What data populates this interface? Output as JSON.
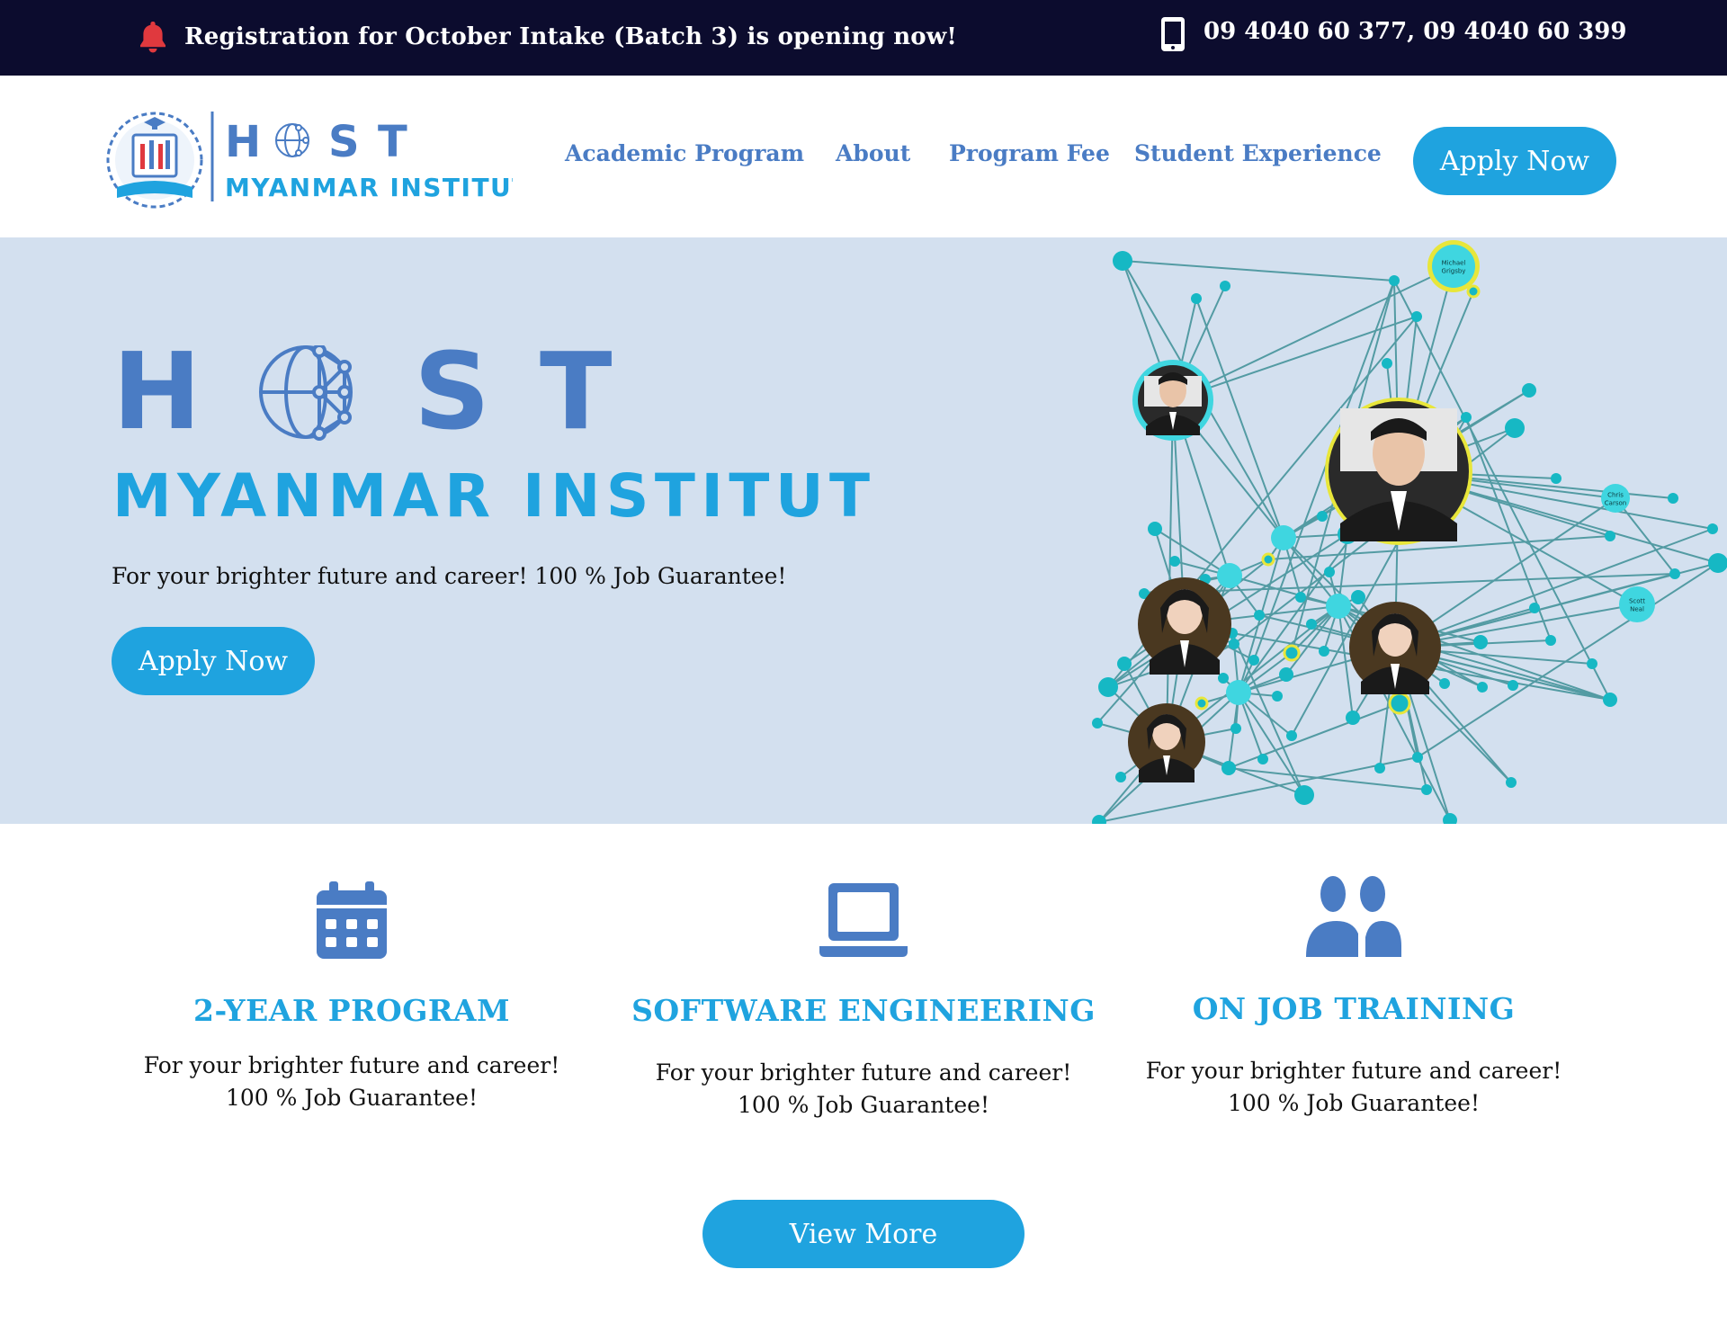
{
  "topbar": {
    "announcement": "Registration for October Intake (Batch 3) is opening now!",
    "phones": "09 4040 60 377, 09 4040 60 399",
    "bell_icon": "bell-icon",
    "phone_icon": "mobile-phone-icon"
  },
  "header": {
    "logo": {
      "word": "H   S T",
      "subtitle": "MYANMAR INSTITUTE"
    },
    "nav": [
      {
        "label": "Academic Program"
      },
      {
        "label": "About"
      },
      {
        "label": "Program Fee"
      },
      {
        "label": "Student Experience"
      }
    ],
    "apply_label": "Apply Now"
  },
  "hero": {
    "subtitle": "MYANMAR INSTITUTE",
    "tagline": "For your brighter future and career! 100 % Job Guarantee!",
    "apply_label": "Apply Now",
    "network_labels": [
      "Michael Grigsby",
      "Chris Carson",
      "Scott Neal"
    ]
  },
  "features": [
    {
      "icon": "calendar-icon",
      "title": "2-YEAR PROGRAM",
      "line1": "For your brighter future and career!",
      "line2": "100 % Job Guarantee!"
    },
    {
      "icon": "laptop-icon",
      "title": "SOFTWARE ENGINEERING",
      "line1": "For your brighter future and career!",
      "line2": "100 % Job Guarantee!"
    },
    {
      "icon": "users-icon",
      "title": "ON JOB TRAINING",
      "line1": "For your brighter future and career!",
      "line2": "100 % Job Guarantee!"
    }
  ],
  "view_more_label": "View More",
  "colors": {
    "topbar_bg": "#0c0c2e",
    "accent_blue": "#1fa3df",
    "logo_blue": "#4a7cc4",
    "hero_bg": "#d3e0ef",
    "node_teal": "#16b8c4",
    "bell_red": "#e0393e"
  }
}
